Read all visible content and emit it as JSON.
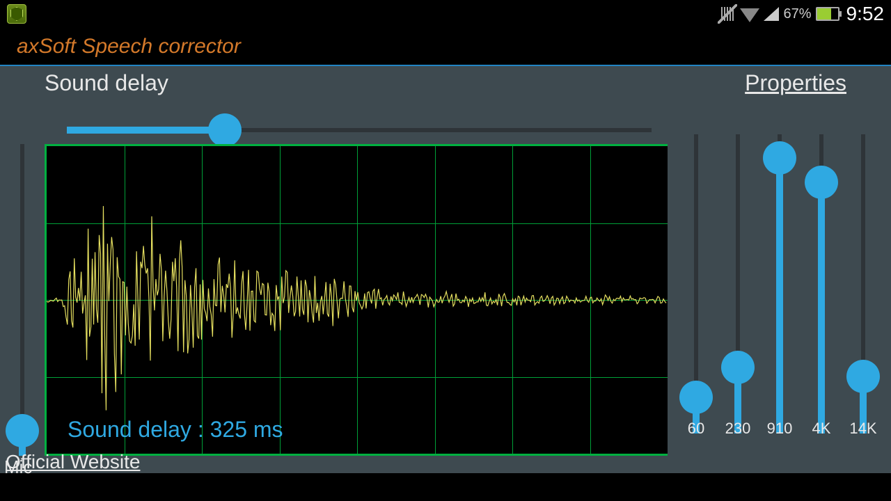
{
  "status": {
    "battery_pct": "67%",
    "clock": "9:52"
  },
  "app_title": "axSoft Speech corrector",
  "sound_delay_label": "Sound delay",
  "properties_label": "Properties",
  "delay_readout": "Sound delay : 325 ms",
  "mic_label": "Mic",
  "footer_link": "Official Website",
  "h_slider_pct": 27,
  "mic_slider_pct": 8,
  "eq": [
    {
      "label": "60",
      "pct": 12
    },
    {
      "label": "230",
      "pct": 22
    },
    {
      "label": "910",
      "pct": 92
    },
    {
      "label": "4K",
      "pct": 84
    },
    {
      "label": "14K",
      "pct": 19
    }
  ],
  "colors": {
    "accent": "#2fa9e2",
    "grid": "#00a038",
    "panel_bg": "#3e4a50"
  }
}
